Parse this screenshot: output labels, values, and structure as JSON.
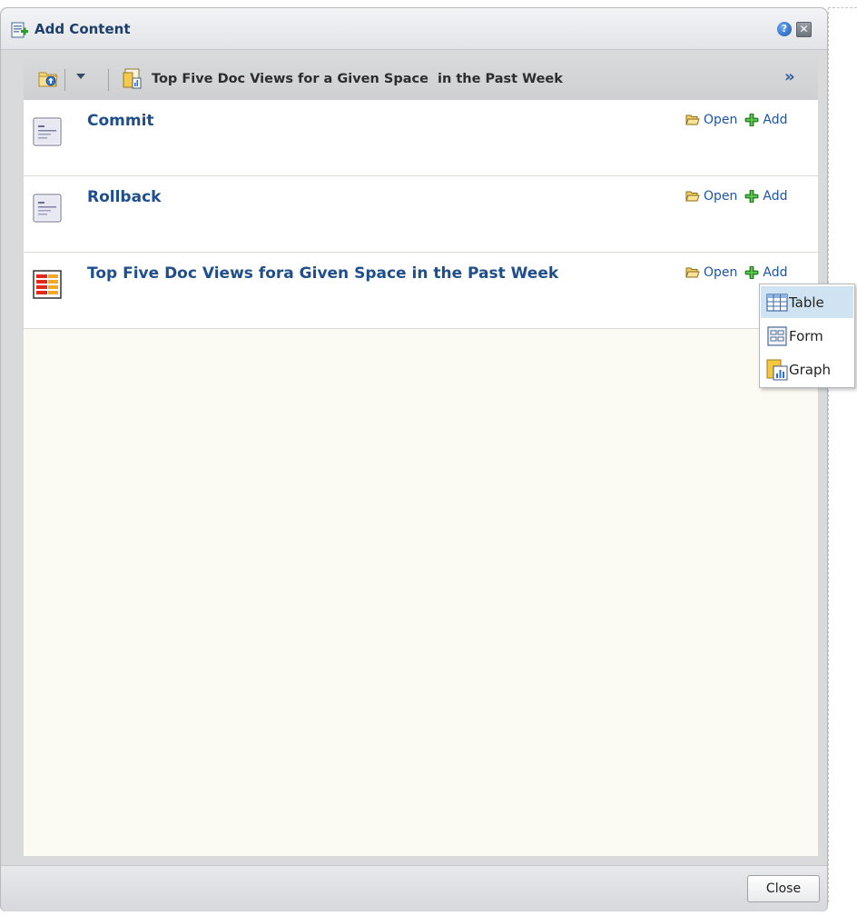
{
  "dialog": {
    "title": "Add Content",
    "help_icon": "help-icon",
    "close_icon": "close-icon",
    "help_glyph": "?",
    "close_glyph": "✕"
  },
  "toolbar": {
    "up_folder_icon": "folder-up-icon",
    "dropdown_icon": "chevron-down-icon",
    "breadcrumb_icon": "report-icon",
    "breadcrumb_title": "Top Five Doc Views for a Given Space  in the Past Week",
    "more_label": "»"
  },
  "items": [
    {
      "title": "Commit",
      "icon": "task-flow-icon",
      "open_label": "Open",
      "add_label": "Add"
    },
    {
      "title": "Rollback",
      "icon": "task-flow-icon",
      "open_label": "Open",
      "add_label": "Add"
    },
    {
      "title": "Top Five Doc Views fora Given Space in the Past Week",
      "icon": "report-bars-icon",
      "open_label": "Open",
      "add_label": "Add"
    }
  ],
  "add_menu": {
    "items": [
      {
        "label": "Table",
        "icon": "table-icon",
        "highlighted": true
      },
      {
        "label": "Form",
        "icon": "form-icon",
        "highlighted": false
      },
      {
        "label": "Graph",
        "icon": "graph-icon",
        "highlighted": false
      }
    ]
  },
  "footer": {
    "close_label": "Close"
  },
  "colors": {
    "link": "#1b55a8",
    "title": "#1e3e6b",
    "item_title": "#1e4e8c",
    "menu_highlight": "#cfe3f3",
    "content_bg": "#fbfbf3"
  }
}
